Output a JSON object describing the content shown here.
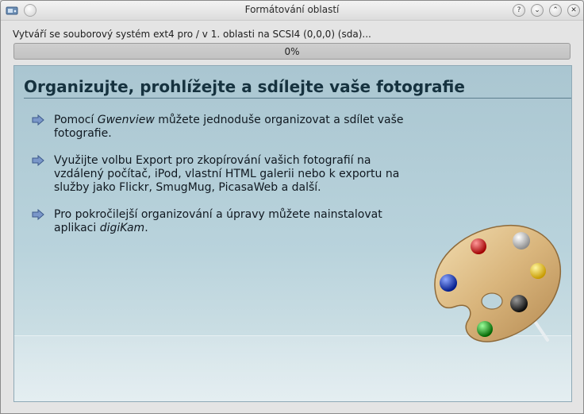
{
  "window": {
    "title": "Formátování oblastí",
    "buttons": {
      "help": "?",
      "minimize": "⌄",
      "maximize": "⌃",
      "close": "✕"
    }
  },
  "status": {
    "text": "Vytváří se souborový systém ext4 pro / v 1. oblasti na SCSI4 (0,0,0) (sda)..."
  },
  "progress": {
    "value": 0,
    "label": "0%"
  },
  "slide": {
    "title": "Organizujte, prohlížejte a sdílejte vaše fotografie",
    "bullets": [
      {
        "before": "Pomocí ",
        "emphasis": "Gwenview",
        "after": " můžete jednoduše organizovat a sdílet vaše fotografie."
      },
      {
        "before": "Využijte volbu Export pro zkopírování vašich fotografií na vzdálený počítač, iPod, vlastní HTML galerii nebo k exportu na služby jako Flickr, SmugMug, PicasaWeb a další.",
        "emphasis": "",
        "after": ""
      },
      {
        "before": "Pro pokročilejší organizování a úpravy můžete nainstalovat aplikaci ",
        "emphasis": "digiKam",
        "after": "."
      }
    ]
  },
  "icons": {
    "app": "partition-app-icon",
    "pin": "pin-icon",
    "bullet": "arrow-right-icon",
    "illustration": "paint-palette-icon"
  }
}
